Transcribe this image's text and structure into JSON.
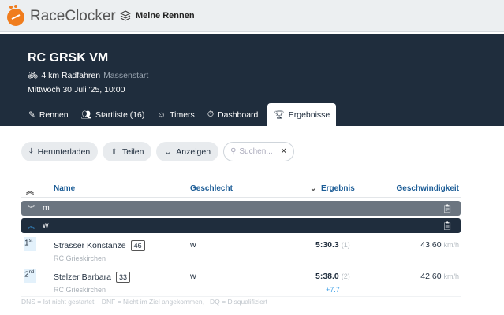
{
  "app": {
    "brand": "RaceClocker",
    "my_races": "Meine Rennen"
  },
  "race": {
    "title": "RC GRSK VM",
    "discipline": "4 km Radfahren",
    "start_type": "Massenstart",
    "date": "Mittwoch 30 Juli '25, 10:00"
  },
  "tabs": [
    {
      "label": "Rennen"
    },
    {
      "label": "Startliste (16)"
    },
    {
      "label": "Timers"
    },
    {
      "label": "Dashboard"
    },
    {
      "label": "Ergebnisse"
    }
  ],
  "toolbar": {
    "download": "Herunterladen",
    "share": "Teilen",
    "show": "Anzeigen",
    "search_placeholder": "Suchen..."
  },
  "table": {
    "headers": {
      "name": "Name",
      "gender": "Geschlecht",
      "result": "Ergebnis",
      "speed": "Geschwindigkeit"
    },
    "groups": [
      {
        "label": "m"
      },
      {
        "label": "w"
      }
    ],
    "rows": [
      {
        "rank": "1",
        "suffix": "st",
        "name": "Strasser Konstanze",
        "bib": "46",
        "club": "RC Grieskirchen",
        "gender": "w",
        "time": "5:30.3",
        "pos": "(1)",
        "gap": "",
        "speed": "43.60",
        "unit": "km/h"
      },
      {
        "rank": "2",
        "suffix": "nd",
        "name": "Stelzer Barbara",
        "bib": "33",
        "club": "RC Grieskirchen",
        "gender": "w",
        "time": "5:38.0",
        "pos": "(2)",
        "gap": "+7.7",
        "speed": "42.60",
        "unit": "km/h"
      }
    ]
  },
  "legend": "DNS = Ist nicht gestartet,   DNF = Nicht im Ziel angekommen,   DQ = Disqualifiziert",
  "colors": {
    "brand": "#f07d1e",
    "navy": "#1f2d3d",
    "accent": "#1b5c96"
  }
}
